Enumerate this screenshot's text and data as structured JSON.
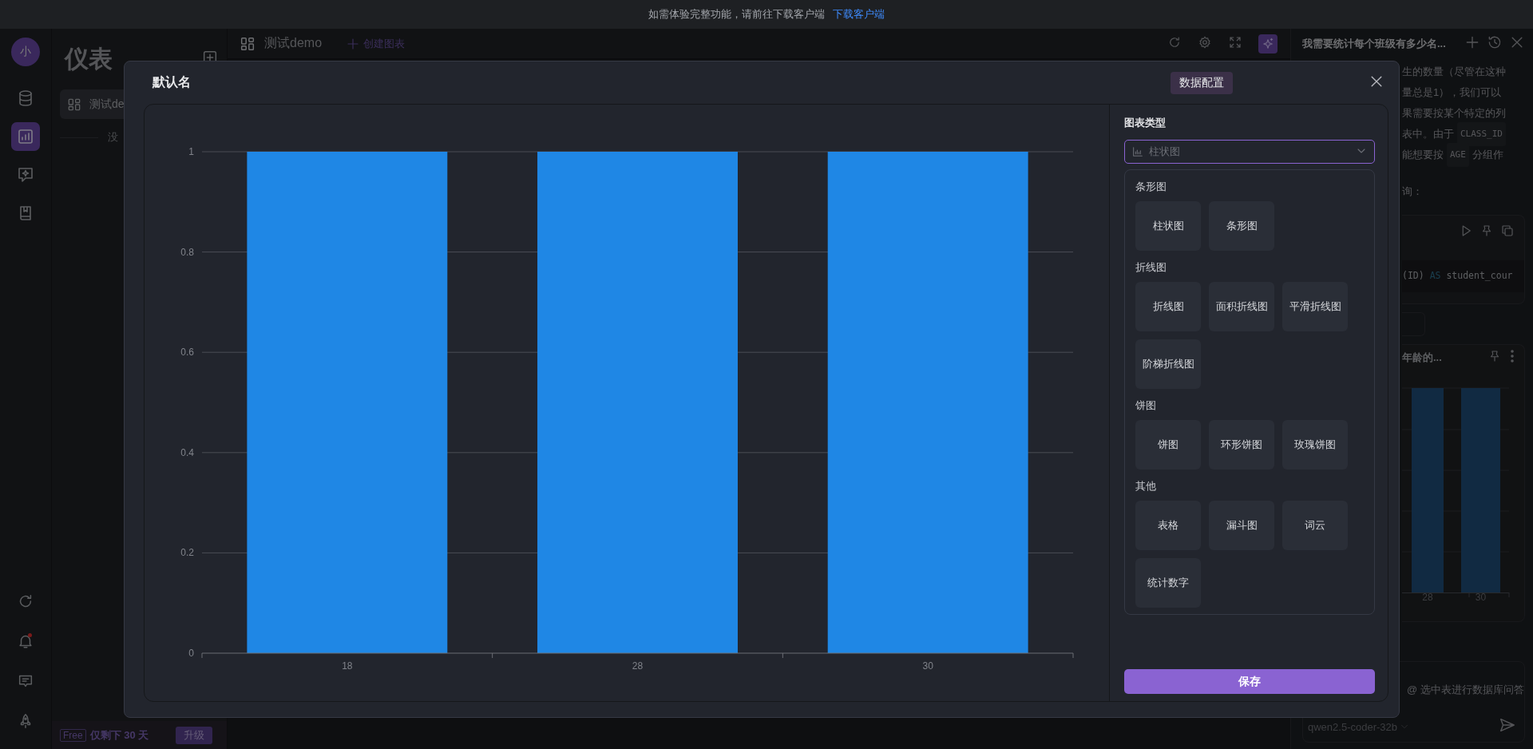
{
  "banner": {
    "message": "如需体验完整功能，请前往下载客户端",
    "link": "下载客户端"
  },
  "rail": {
    "avatar": "小",
    "items": [
      {
        "selected": false
      },
      {
        "selected": true
      },
      {
        "selected": false
      },
      {
        "selected": false
      }
    ],
    "bell_dot": true
  },
  "sidebar": {
    "title": "仪表",
    "items": [
      {
        "label": "测试de",
        "selected": true
      }
    ],
    "empty_text": "没"
  },
  "plan": {
    "badge": "Free",
    "remaining": "仅剩下 30 天",
    "upgrade": "升级"
  },
  "toolbar": {
    "dashboard": "测试demo",
    "create": "创建图表",
    "assistant_open": true
  },
  "chat": {
    "title": "我需要统计每个班级有多少名...",
    "lines": [
      [
        {
          "kind": "text",
          "text": "生的数量（尽管在这种"
        }
      ],
      [
        {
          "kind": "text",
          "text": "量总是1），我们可以"
        }
      ],
      [
        {
          "kind": "text",
          "text": "果需要按某个特定的列"
        }
      ],
      [
        {
          "kind": "text",
          "text": "表中。由于"
        },
        {
          "kind": "code",
          "text": "CLASS_ID"
        }
      ],
      [
        {
          "kind": "text",
          "text": "能想要按"
        },
        {
          "kind": "code",
          "text": "AGE"
        },
        {
          "kind": "text",
          "text": "分组作"
        }
      ],
      [
        {
          "kind": "text",
          "text": "询："
        }
      ]
    ],
    "code": [
      {
        "kind": "text",
        "text": "(ID) "
      },
      {
        "kind": "keyword",
        "text": "AS"
      },
      {
        "kind": "text",
        "text": " student_cour"
      }
    ],
    "card_title": "年龄的...",
    "card_x_labels": [
      "28",
      "30"
    ],
    "placeholder": "@ 选中表进行数据库问答",
    "model": "qwen2.5-coder-32b"
  },
  "modal": {
    "title": "默认名",
    "tabs": [
      {
        "label": "数据配置",
        "selected": true
      }
    ],
    "chart_data": {
      "type": "bar",
      "categories": [
        "18",
        "28",
        "30"
      ],
      "series": [
        {
          "color": "#1f87e5",
          "values": [
            1,
            1,
            1
          ]
        }
      ],
      "ylim": [
        0,
        1
      ],
      "grid": true,
      "yticks": [
        0,
        0.2,
        0.4,
        0.6,
        0.8,
        1
      ]
    },
    "config": {
      "section": "图表类型",
      "select": {
        "value": "柱状图"
      },
      "groups": [
        {
          "name": "条形图",
          "options": [
            "柱状图",
            "条形图"
          ]
        },
        {
          "name": "折线图",
          "options": [
            "折线图",
            "面积折线图",
            "平滑折线图",
            "阶梯折线图"
          ]
        },
        {
          "name": "饼图",
          "options": [
            "饼图",
            "环形饼图",
            "玫瑰饼图"
          ]
        },
        {
          "name": "其他",
          "options": [
            "表格",
            "漏斗图",
            "词云",
            "统计数字"
          ]
        }
      ]
    },
    "save": "保存"
  }
}
